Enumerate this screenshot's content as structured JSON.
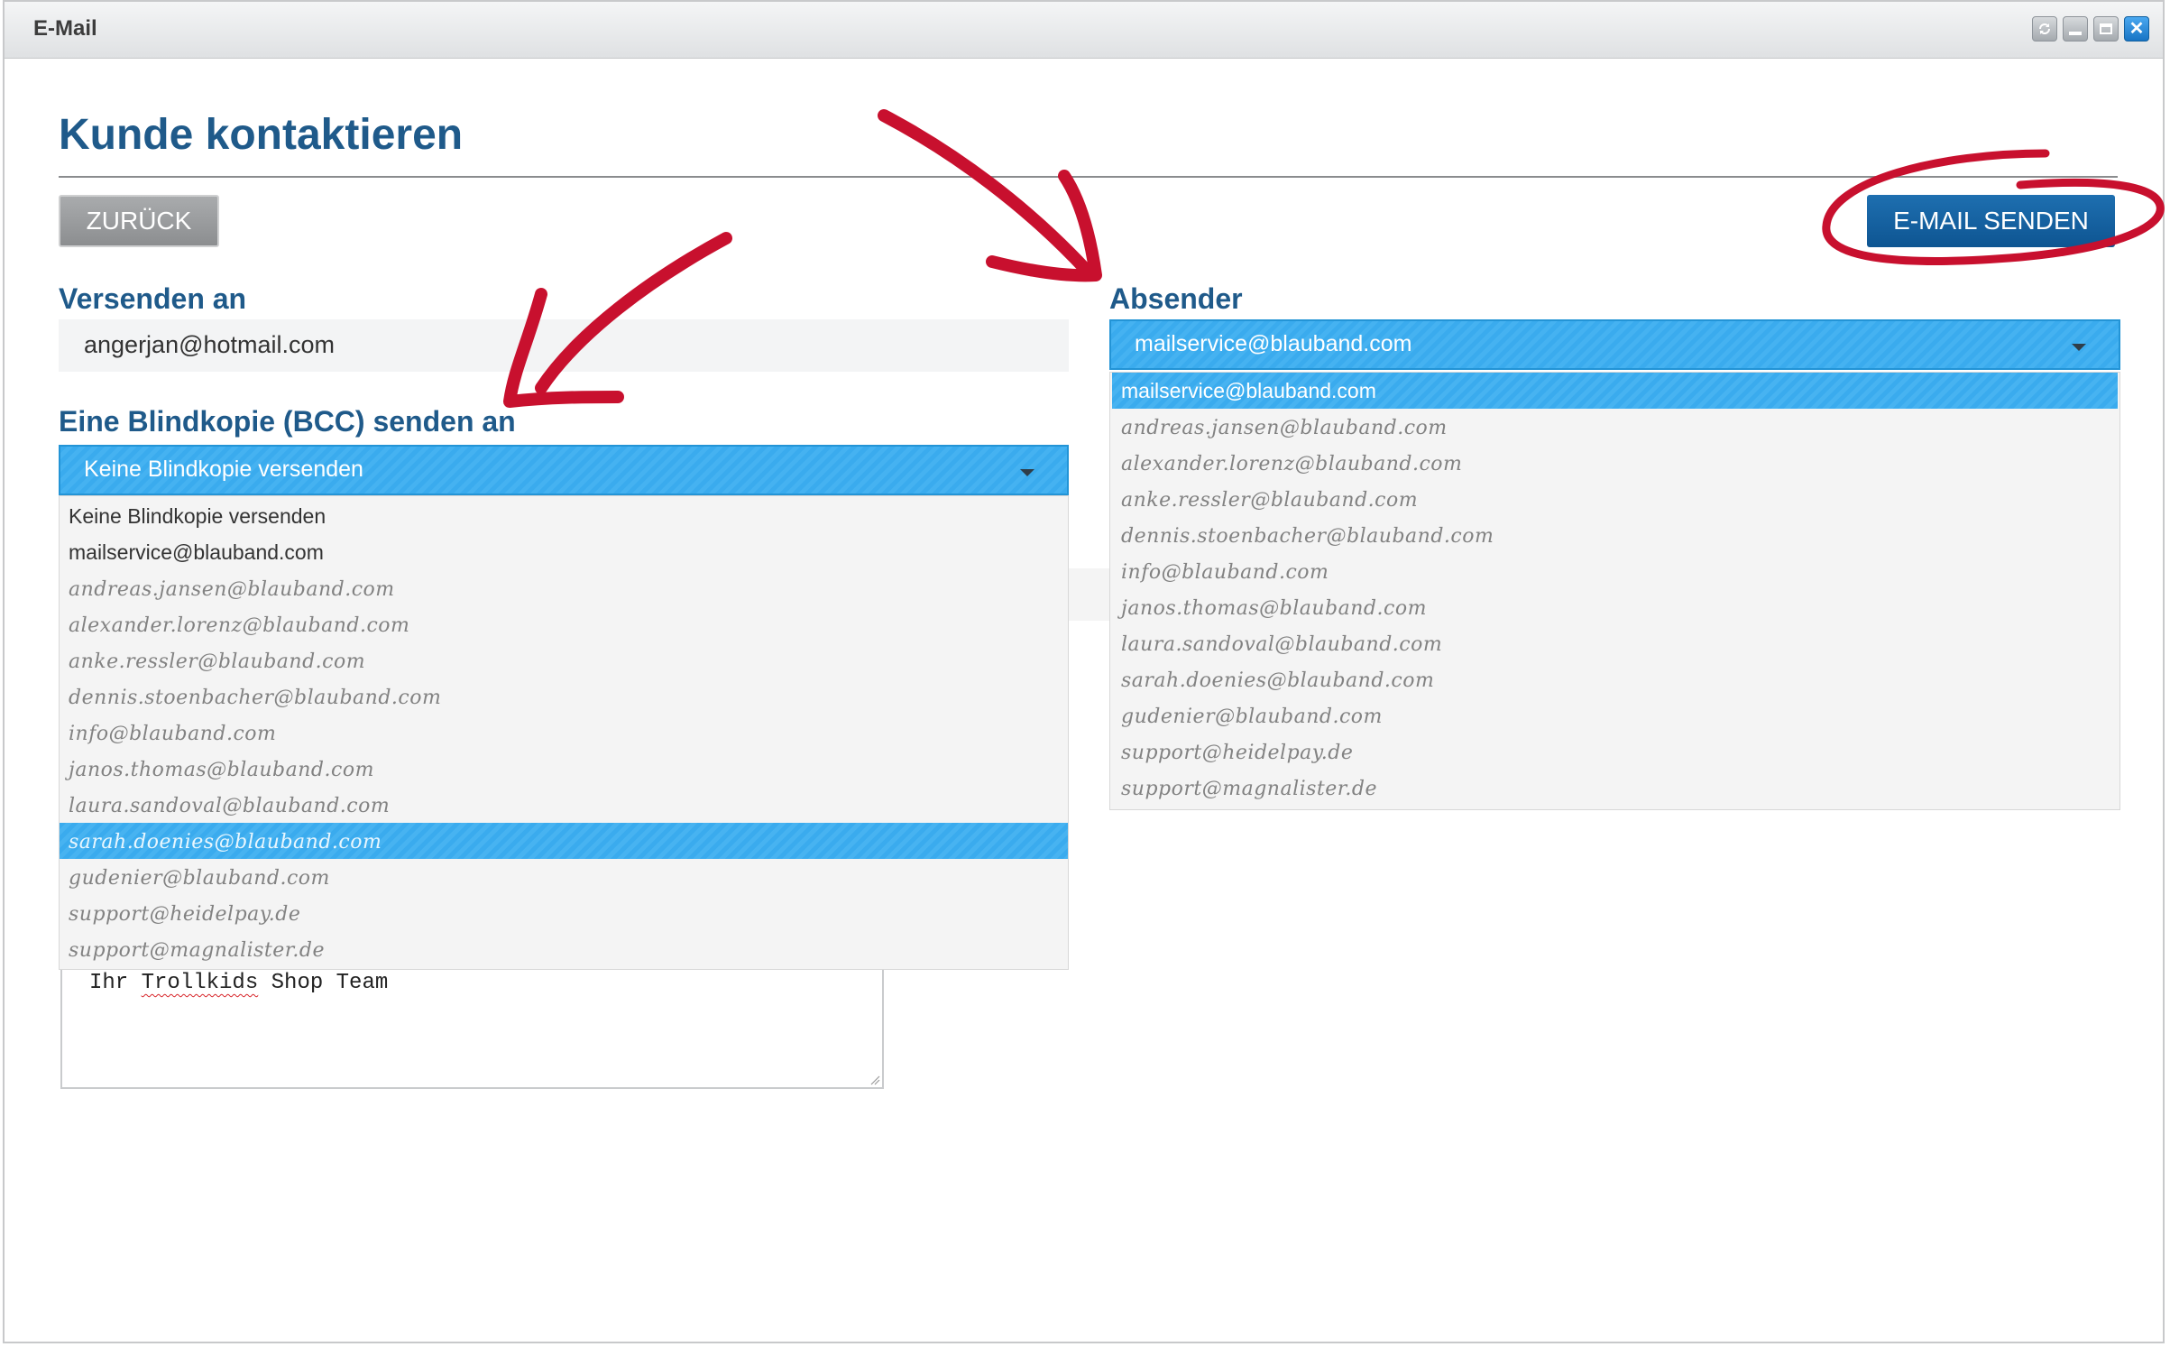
{
  "window": {
    "title": "E-Mail"
  },
  "page": {
    "heading": "Kunde kontaktieren"
  },
  "toolbar": {
    "back_label": "ZURÜCK",
    "send_label": "E-MAIL SENDEN"
  },
  "recipient": {
    "label": "Versenden an",
    "value": "angerjan@hotmail.com"
  },
  "bcc": {
    "label": "Eine Blindkopie (BCC) senden an",
    "selected": "Keine Blindkopie versenden",
    "options": [
      "Keine Blindkopie versenden",
      "mailservice@blauband.com",
      "andreas.jansen@blauband.com",
      "alexander.lorenz@blauband.com",
      "anke.ressler@blauband.com",
      "dennis.stoenbacher@blauband.com",
      "info@blauband.com",
      "janos.thomas@blauband.com",
      "laura.sandoval@blauband.com",
      "sarah.doenies@blauband.com",
      "gudenier@blauband.com",
      "support@heidelpay.de",
      "support@magnalister.de"
    ],
    "highlighted_index": 9
  },
  "sender": {
    "label": "Absender",
    "selected": "mailservice@blauband.com",
    "options": [
      "mailservice@blauband.com",
      "andreas.jansen@blauband.com",
      "alexander.lorenz@blauband.com",
      "anke.ressler@blauband.com",
      "dennis.stoenbacher@blauband.com",
      "info@blauband.com",
      "janos.thomas@blauband.com",
      "laura.sandoval@blauband.com",
      "sarah.doenies@blauband.com",
      "gudenier@blauband.com",
      "support@heidelpay.de",
      "support@magnalister.de"
    ],
    "highlighted_index": 0
  },
  "message": {
    "line_prefix": "Ihr ",
    "line_misspelled": "Trollkids",
    "line_suffix": " Shop Team"
  },
  "icons": {
    "refresh": "refresh-icon",
    "minimize": "minimize-icon",
    "maximize": "maximize-icon",
    "close": "close-icon",
    "dropdown": "chevron-down-icon"
  },
  "colors": {
    "heading": "#1f5a8a",
    "select_blue": "#3aabee",
    "send_button": "#0e5592",
    "annotation_red": "#c8102e"
  }
}
